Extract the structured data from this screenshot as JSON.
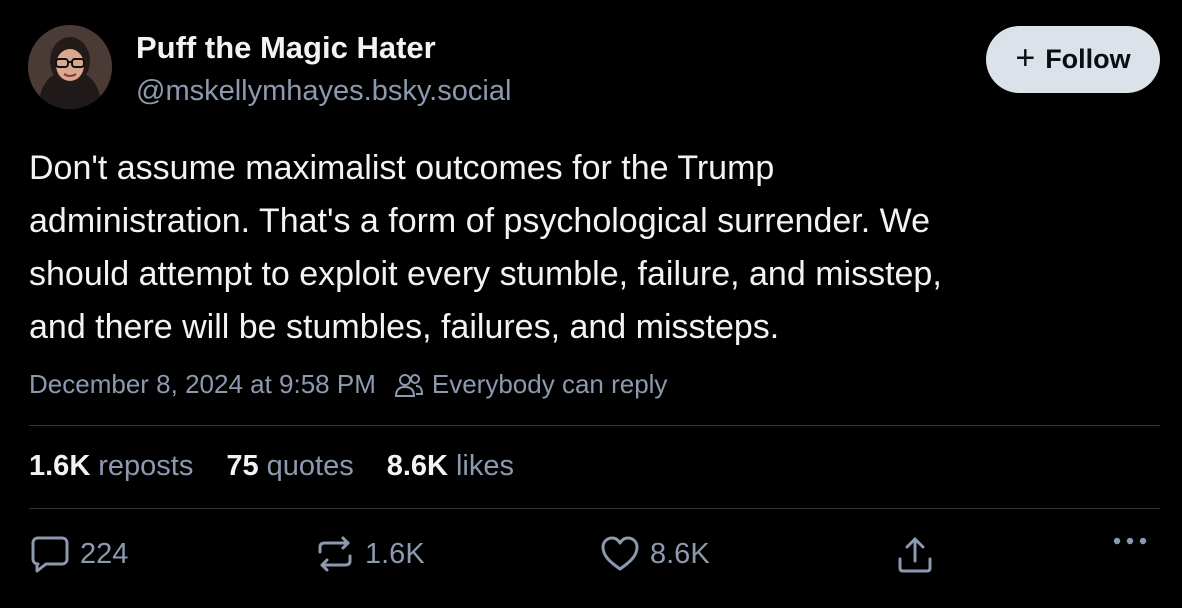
{
  "post": {
    "author": {
      "display_name": "Puff the Magic Hater",
      "handle": "@mskellymhayes.bsky.social"
    },
    "follow_button": {
      "icon": "plus-icon",
      "label": "Follow"
    },
    "text_lines": [
      "Don't assume maximalist outcomes for the Trump",
      "administration. That's a form of psychological surrender. We",
      "should attempt to exploit every stumble, failure, and misstep,",
      "and there will be stumbles, failures, and missteps."
    ],
    "timestamp": "December 8, 2024 at 9:58 PM",
    "reply_setting": {
      "icon": "people-icon",
      "label": "Everybody can reply"
    },
    "stats": {
      "reposts": {
        "value": "1.6K",
        "label": "reposts"
      },
      "quotes": {
        "value": "75",
        "label": "quotes"
      },
      "likes": {
        "value": "8.6K",
        "label": "likes"
      }
    },
    "actions": {
      "reply": {
        "icon": "comment-icon",
        "count": "224"
      },
      "repost": {
        "icon": "repost-icon",
        "count": "1.6K"
      },
      "like": {
        "icon": "heart-icon",
        "count": "8.6K"
      },
      "share": {
        "icon": "share-icon"
      },
      "more": {
        "icon": "more-icon"
      }
    }
  },
  "colors": {
    "background": "#000000",
    "primary_text": "#f1f3f5",
    "secondary_text": "#8d99ae",
    "follow_button_bg": "#dce2ea",
    "divider": "#2e3640"
  }
}
